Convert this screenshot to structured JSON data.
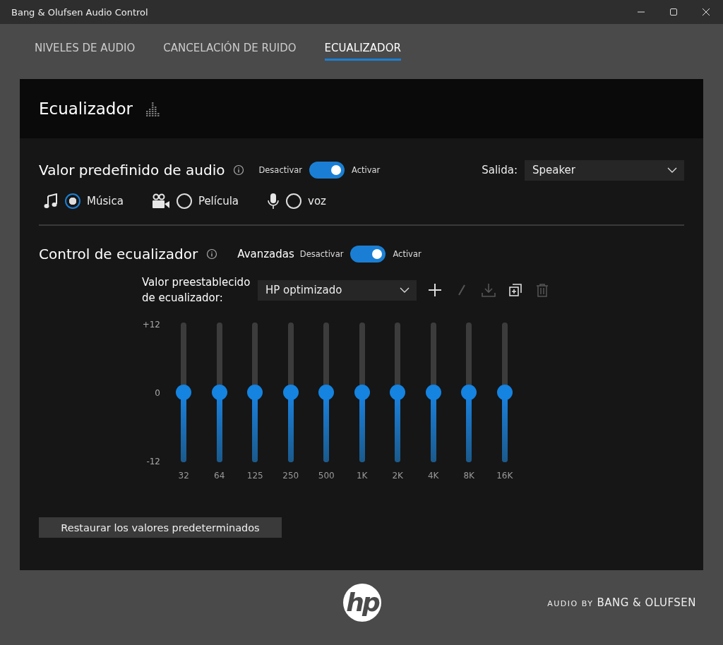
{
  "window": {
    "title": "Bang & Olufsen Audio Control"
  },
  "tabs": [
    {
      "label": "NIVELES DE AUDIO",
      "selected": false
    },
    {
      "label": "CANCELACIÓN DE RUIDO",
      "selected": false
    },
    {
      "label": "ECUALIZADOR",
      "selected": true
    }
  ],
  "panel": {
    "title": "Ecualizador"
  },
  "audio_preset": {
    "title": "Valor predefinido de audio",
    "off_label": "Desactivar",
    "on_label": "Activar",
    "on": true,
    "output_label": "Salida:",
    "output_value": "Speaker",
    "modes": [
      {
        "kind": "music",
        "label": "Música",
        "selected": true
      },
      {
        "kind": "film",
        "label": "Película",
        "selected": false
      },
      {
        "kind": "mic",
        "label": "voz",
        "selected": false
      }
    ]
  },
  "eq_control": {
    "title": "Control de ecualizador",
    "advanced_label": "Avanzadas",
    "off_label": "Desactivar",
    "on_label": "Activar",
    "on": true,
    "preset_label": "Valor preestablecido de ecualizador:",
    "preset_value": "HP optimizado",
    "actions": [
      {
        "kind": "add",
        "disabled": false
      },
      {
        "kind": "edit",
        "disabled": true
      },
      {
        "kind": "save",
        "disabled": true
      },
      {
        "kind": "duplicate",
        "disabled": false
      },
      {
        "kind": "delete",
        "disabled": true
      }
    ],
    "scale": [
      "+12",
      "0",
      "-12"
    ],
    "bands": [
      {
        "label": "32",
        "level": 0.5
      },
      {
        "label": "64",
        "level": 0.5
      },
      {
        "label": "125",
        "level": 0.5
      },
      {
        "label": "250",
        "level": 0.5
      },
      {
        "label": "500",
        "level": 0.5
      },
      {
        "label": "1K",
        "level": 0.5
      },
      {
        "label": "2K",
        "level": 0.5
      },
      {
        "label": "4K",
        "level": 0.5
      },
      {
        "label": "8K",
        "level": 0.5
      },
      {
        "label": "16K",
        "level": 0.5
      }
    ]
  },
  "restore_button": "Restaurar los valores predeterminados",
  "footer": {
    "logo": "hp",
    "tagline_small": "AUDIO BY",
    "tagline_brand": "BANG & OLUFSEN"
  }
}
